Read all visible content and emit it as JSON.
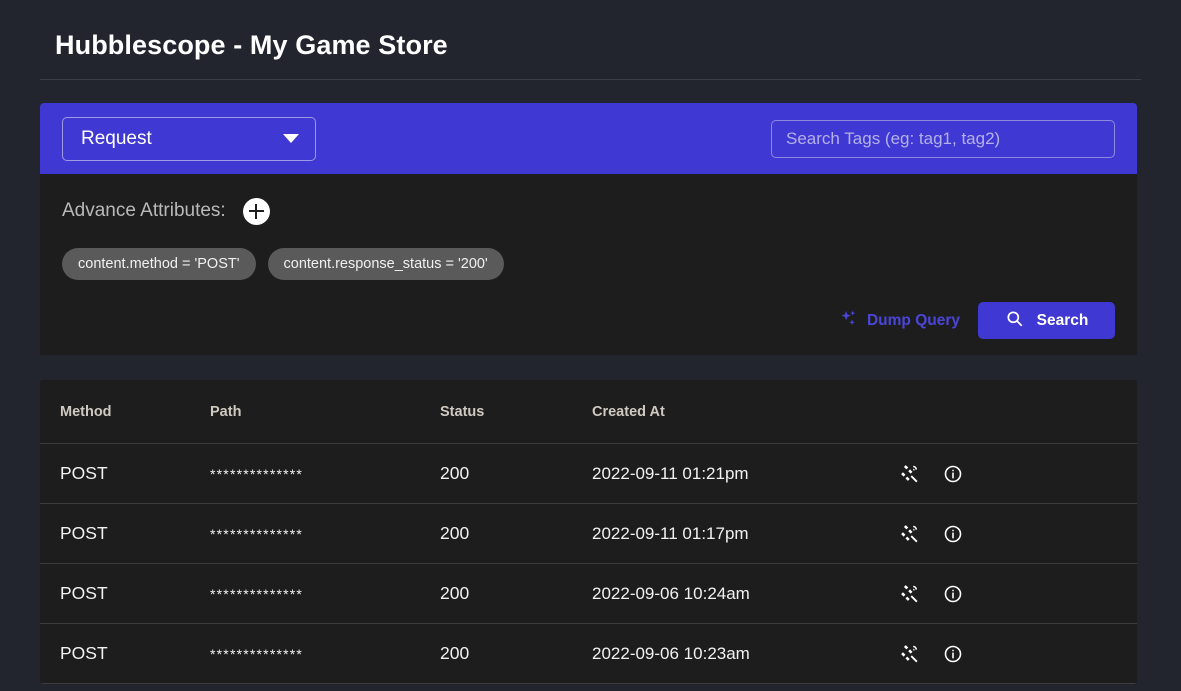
{
  "header": {
    "title": "Hubblescope - My Game Store"
  },
  "query": {
    "type_select": {
      "value": "Request",
      "caret_icon": "chevron-down-icon"
    },
    "tag_search": {
      "value": "",
      "placeholder": "Search Tags (eg: tag1, tag2)"
    },
    "advance_attributes": {
      "label": "Advance Attributes:",
      "add_icon": "plus-circle-icon",
      "chips": [
        "content.method = 'POST'",
        "content.response_status = '200'"
      ]
    },
    "actions": {
      "dump_query_label": "Dump Query",
      "dump_query_icon": "sparkle-icon",
      "search_label": "Search",
      "search_icon": "search-icon"
    }
  },
  "results": {
    "columns": [
      "Method",
      "Path",
      "Status",
      "Created At"
    ],
    "row_icons": [
      "satellite-icon",
      "info-icon"
    ],
    "rows": [
      {
        "method": "POST",
        "path": "**************",
        "status": "200",
        "created_at": "2022-09-11 01:21pm"
      },
      {
        "method": "POST",
        "path": "**************",
        "status": "200",
        "created_at": "2022-09-11 01:17pm"
      },
      {
        "method": "POST",
        "path": "**************",
        "status": "200",
        "created_at": "2022-09-06 10:24am"
      },
      {
        "method": "POST",
        "path": "**************",
        "status": "200",
        "created_at": "2022-09-06 10:23am"
      }
    ]
  },
  "colors": {
    "page_background": "#22252d",
    "card_background": "#1d1d1d",
    "accent_indigo": "#4038d2",
    "chip_background": "#5a5a5a",
    "divider": "#3d3d3d"
  }
}
